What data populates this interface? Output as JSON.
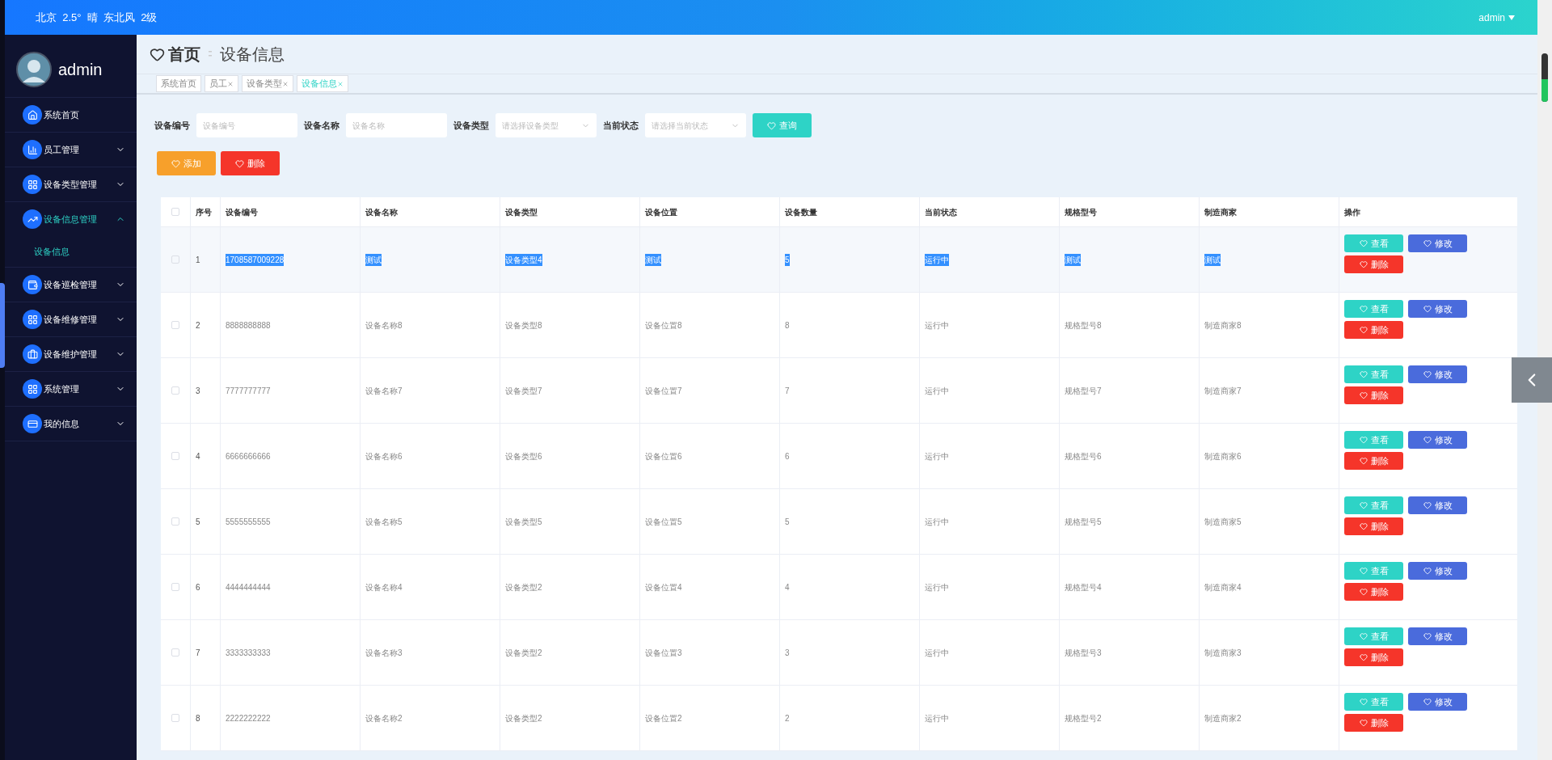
{
  "header": {
    "weather": "北京  2.5°  晴  东北风  2级",
    "user": "admin"
  },
  "sidebar": {
    "user": "admin",
    "items": [
      {
        "label": "系统首页",
        "expandable": false,
        "selected": false
      },
      {
        "label": "员工管理",
        "expandable": true,
        "expanded": false,
        "selected": false
      },
      {
        "label": "设备类型管理",
        "expandable": true,
        "expanded": false,
        "selected": false
      },
      {
        "label": "设备信息管理",
        "expandable": true,
        "expanded": true,
        "selected": true,
        "children": [
          {
            "label": "设备信息",
            "selected": true
          }
        ]
      },
      {
        "label": "设备巡检管理",
        "expandable": true,
        "expanded": false,
        "selected": false
      },
      {
        "label": "设备维修管理",
        "expandable": true,
        "expanded": false,
        "selected": false
      },
      {
        "label": "设备维护管理",
        "expandable": true,
        "expanded": false,
        "selected": false
      },
      {
        "label": "系统管理",
        "expandable": true,
        "expanded": false,
        "selected": false
      },
      {
        "label": "我的信息",
        "expandable": true,
        "expanded": false,
        "selected": false
      }
    ]
  },
  "breadcrumb": {
    "home": "首页",
    "current": "设备信息"
  },
  "tabs": [
    {
      "label": "系统首页",
      "closable": false,
      "selected": false
    },
    {
      "label": "员工",
      "closable": true,
      "selected": false
    },
    {
      "label": "设备类型",
      "closable": true,
      "selected": false
    },
    {
      "label": "设备信息",
      "closable": true,
      "selected": true
    }
  ],
  "search": {
    "fields": [
      {
        "label": "设备编号",
        "kind": "input",
        "placeholder": "设备编号"
      },
      {
        "label": "设备名称",
        "kind": "input",
        "placeholder": "设备名称"
      },
      {
        "label": "设备类型",
        "kind": "select",
        "placeholder": "请选择设备类型"
      },
      {
        "label": "当前状态",
        "kind": "select",
        "placeholder": "请选择当前状态"
      }
    ],
    "button": "查询"
  },
  "toolbar": [
    {
      "label": "添加",
      "kind": "add"
    },
    {
      "label": "删除",
      "kind": "delete"
    }
  ],
  "table": {
    "all_checked": false,
    "columns": [
      "序号",
      "设备编号",
      "设备名称",
      "设备类型",
      "设备位置",
      "设备数量",
      "当前状态",
      "规格型号",
      "制造商家",
      "操作"
    ],
    "rows": [
      {
        "checked": false,
        "text_selected": true,
        "cells": [
          "1",
          "1708587009228",
          "测试",
          "设备类型4",
          "测试",
          "5",
          "运行中",
          "测试",
          "测试"
        ],
        "actions": [
          {
            "label": "查看",
            "kind": "view"
          },
          {
            "label": "修改",
            "kind": "edit"
          },
          {
            "label": "删除",
            "kind": "delete"
          }
        ]
      },
      {
        "checked": false,
        "text_selected": false,
        "cells": [
          "2",
          "8888888888",
          "设备名称8",
          "设备类型8",
          "设备位置8",
          "8",
          "运行中",
          "规格型号8",
          "制造商家8"
        ],
        "actions": [
          {
            "label": "查看",
            "kind": "view"
          },
          {
            "label": "修改",
            "kind": "edit"
          },
          {
            "label": "删除",
            "kind": "delete"
          }
        ]
      },
      {
        "checked": false,
        "text_selected": false,
        "cells": [
          "3",
          "7777777777",
          "设备名称7",
          "设备类型7",
          "设备位置7",
          "7",
          "运行中",
          "规格型号7",
          "制造商家7"
        ],
        "actions": [
          {
            "label": "查看",
            "kind": "view"
          },
          {
            "label": "修改",
            "kind": "edit"
          },
          {
            "label": "删除",
            "kind": "delete"
          }
        ]
      },
      {
        "checked": false,
        "text_selected": false,
        "cells": [
          "4",
          "6666666666",
          "设备名称6",
          "设备类型6",
          "设备位置6",
          "6",
          "运行中",
          "规格型号6",
          "制造商家6"
        ],
        "actions": [
          {
            "label": "查看",
            "kind": "view"
          },
          {
            "label": "修改",
            "kind": "edit"
          },
          {
            "label": "删除",
            "kind": "delete"
          }
        ]
      },
      {
        "checked": false,
        "text_selected": false,
        "cells": [
          "5",
          "5555555555",
          "设备名称5",
          "设备类型5",
          "设备位置5",
          "5",
          "运行中",
          "规格型号5",
          "制造商家5"
        ],
        "actions": [
          {
            "label": "查看",
            "kind": "view"
          },
          {
            "label": "修改",
            "kind": "edit"
          },
          {
            "label": "删除",
            "kind": "delete"
          }
        ]
      },
      {
        "checked": false,
        "text_selected": false,
        "cells": [
          "6",
          "4444444444",
          "设备名称4",
          "设备类型2",
          "设备位置4",
          "4",
          "运行中",
          "规格型号4",
          "制造商家4"
        ],
        "actions": [
          {
            "label": "查看",
            "kind": "view"
          },
          {
            "label": "修改",
            "kind": "edit"
          },
          {
            "label": "删除",
            "kind": "delete"
          }
        ]
      },
      {
        "checked": false,
        "text_selected": false,
        "cells": [
          "7",
          "3333333333",
          "设备名称3",
          "设备类型2",
          "设备位置3",
          "3",
          "运行中",
          "规格型号3",
          "制造商家3"
        ],
        "actions": [
          {
            "label": "查看",
            "kind": "view"
          },
          {
            "label": "修改",
            "kind": "edit"
          },
          {
            "label": "删除",
            "kind": "delete"
          }
        ]
      },
      {
        "checked": false,
        "text_selected": false,
        "cells": [
          "8",
          "2222222222",
          "设备名称2",
          "设备类型2",
          "设备位置2",
          "2",
          "运行中",
          "规格型号2",
          "制造商家2"
        ],
        "actions": [
          {
            "label": "查看",
            "kind": "view"
          },
          {
            "label": "修改",
            "kind": "edit"
          },
          {
            "label": "删除",
            "kind": "delete"
          }
        ]
      }
    ]
  }
}
